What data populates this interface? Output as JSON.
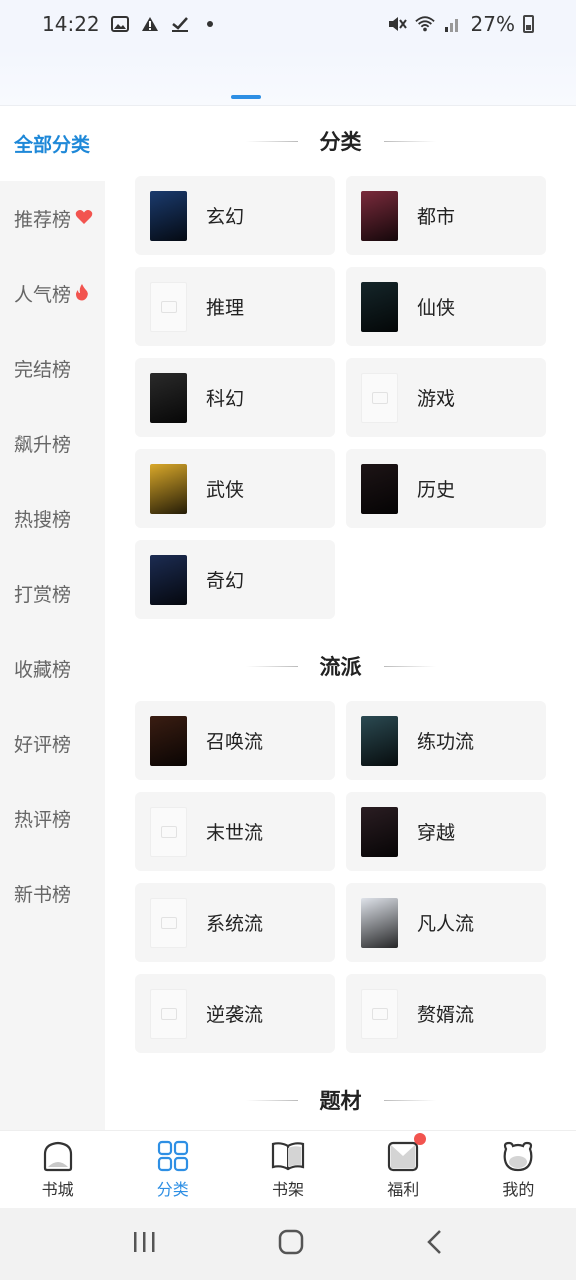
{
  "status_bar": {
    "time": "14:22",
    "battery": "27%",
    "icons": [
      "image-icon",
      "warning-icon",
      "check-icon",
      "dot-icon",
      "mute-icon",
      "wifi-icon",
      "signal-icon",
      "battery-icon"
    ]
  },
  "sidebar": {
    "items": [
      {
        "label": "全部分类",
        "badge": "",
        "active": true
      },
      {
        "label": "推荐榜",
        "badge": "heart-icon",
        "active": false
      },
      {
        "label": "人气榜",
        "badge": "fire-icon",
        "active": false
      },
      {
        "label": "完结榜",
        "badge": "",
        "active": false
      },
      {
        "label": "飙升榜",
        "badge": "",
        "active": false
      },
      {
        "label": "热搜榜",
        "badge": "",
        "active": false
      },
      {
        "label": "打赏榜",
        "badge": "",
        "active": false
      },
      {
        "label": "收藏榜",
        "badge": "",
        "active": false
      },
      {
        "label": "好评榜",
        "badge": "",
        "active": false
      },
      {
        "label": "热评榜",
        "badge": "",
        "active": false
      },
      {
        "label": "新书榜",
        "badge": "",
        "active": false
      }
    ]
  },
  "sections": [
    {
      "title": "分类",
      "items": [
        {
          "label": "玄幻",
          "cover": "#1b3b6e"
        },
        {
          "label": "都市",
          "cover": "#7a2b3c"
        },
        {
          "label": "推理",
          "cover": ""
        },
        {
          "label": "仙侠",
          "cover": "#15262a"
        },
        {
          "label": "科幻",
          "cover": "#2a2a2a"
        },
        {
          "label": "游戏",
          "cover": ""
        },
        {
          "label": "武侠",
          "cover": "#d9a82a"
        },
        {
          "label": "历史",
          "cover": "#1d1416"
        },
        {
          "label": "奇幻",
          "cover": "#1c2c52"
        }
      ]
    },
    {
      "title": "流派",
      "items": [
        {
          "label": "召唤流",
          "cover": "#3a1d12"
        },
        {
          "label": "练功流",
          "cover": "#2b4a52"
        },
        {
          "label": "末世流",
          "cover": ""
        },
        {
          "label": "穿越",
          "cover": "#2a1d22"
        },
        {
          "label": "系统流",
          "cover": ""
        },
        {
          "label": "凡人流",
          "cover": "#dfe3ea"
        },
        {
          "label": "逆袭流",
          "cover": ""
        },
        {
          "label": "赘婿流",
          "cover": ""
        }
      ]
    },
    {
      "title": "题材",
      "items": []
    }
  ],
  "bottom_nav": {
    "items": [
      {
        "label": "书城",
        "icon": "home-icon",
        "active": false,
        "dot": false
      },
      {
        "label": "分类",
        "icon": "category-grid-icon",
        "active": true,
        "dot": false
      },
      {
        "label": "书架",
        "icon": "bookshelf-icon",
        "active": false,
        "dot": false
      },
      {
        "label": "福利",
        "icon": "gift-envelope-icon",
        "active": false,
        "dot": true
      },
      {
        "label": "我的",
        "icon": "profile-icon",
        "active": false,
        "dot": false
      }
    ]
  },
  "colors": {
    "accent": "#2e8fe4",
    "sidebar_bg": "#f5f5f5",
    "card_bg": "#f5f5f5",
    "badge_red": "#f2544f"
  }
}
